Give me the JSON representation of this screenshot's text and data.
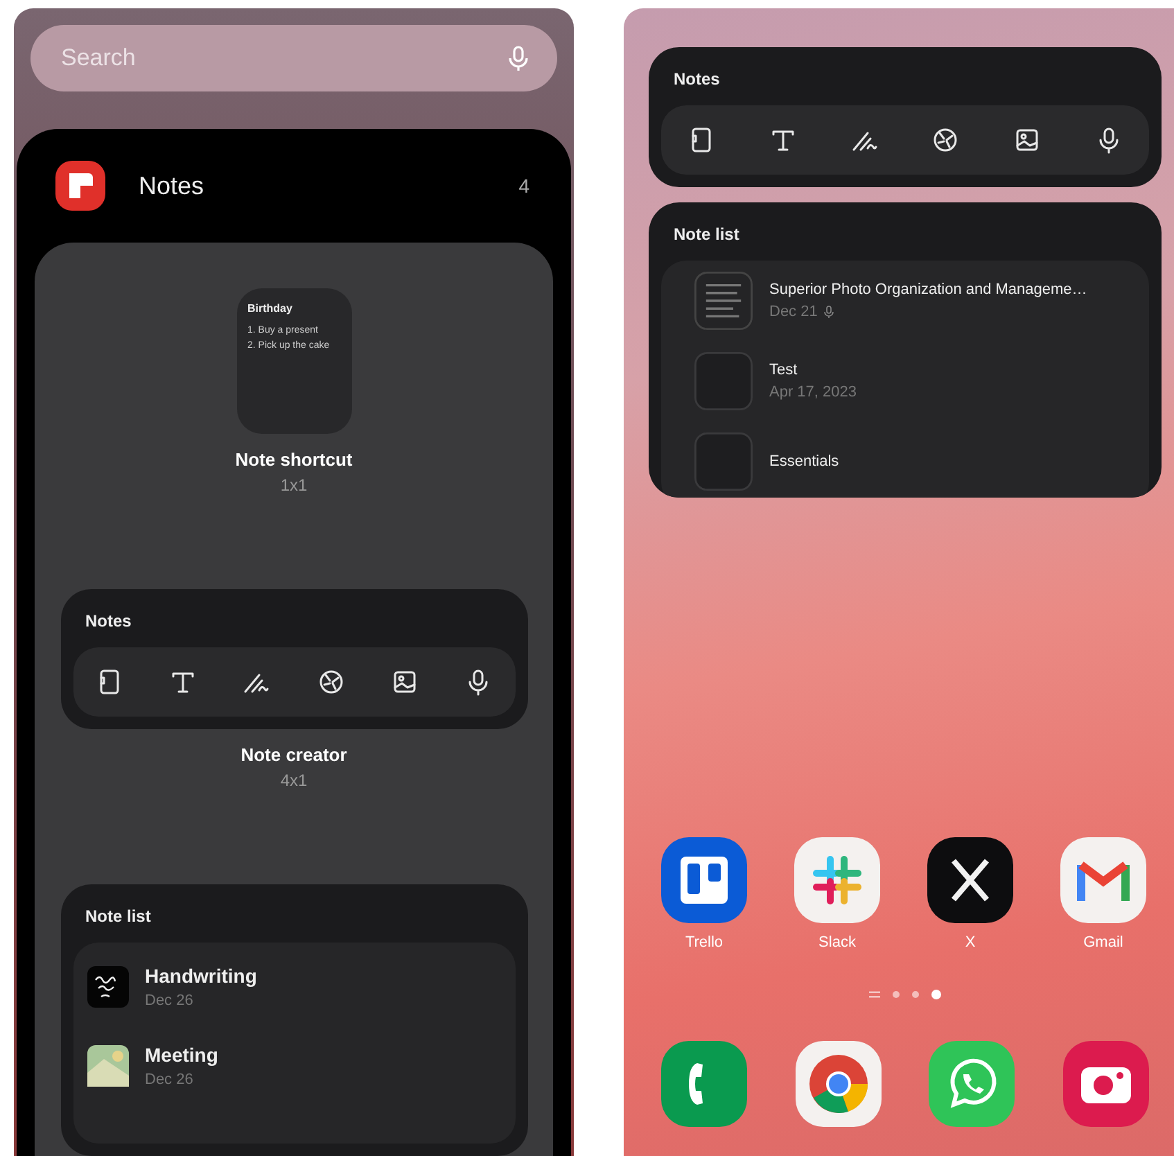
{
  "left_screen": {
    "search": {
      "placeholder": "Search"
    },
    "app": {
      "name": "Notes",
      "count": "4"
    },
    "widgets": [
      {
        "kind": "shortcut",
        "preview": {
          "title": "Birthday",
          "lines": [
            "1. Buy a present",
            "2. Pick up the cake"
          ]
        },
        "name": "Note shortcut",
        "size": "1x1"
      },
      {
        "kind": "creator",
        "title": "Notes",
        "name": "Note creator",
        "size": "4x1"
      },
      {
        "kind": "list",
        "title": "Note list",
        "items": [
          {
            "title": "Handwriting",
            "date": "Dec 26",
            "kind": "handwriting"
          },
          {
            "title": "Meeting",
            "date": "Dec 26",
            "kind": "photo"
          }
        ]
      }
    ]
  },
  "right_screen": {
    "widgets": [
      {
        "kind": "creator",
        "title": "Notes"
      },
      {
        "kind": "list",
        "title": "Note list",
        "items": [
          {
            "title": "Superior Photo Organization and Manageme…",
            "date": "Dec 21",
            "voice": true,
            "kind": "document"
          },
          {
            "title": "Test",
            "date": "Apr 17, 2023",
            "voice": false,
            "kind": "blank"
          },
          {
            "title": "Essentials",
            "kind": "blank"
          }
        ]
      }
    ],
    "apps": [
      {
        "label": "Trello",
        "kind": "board"
      },
      {
        "label": "Slack",
        "kind": "hash"
      },
      {
        "label": "X",
        "kind": "cross"
      },
      {
        "label": "Gmail",
        "kind": "mail"
      }
    ],
    "page_indicator": [
      {
        "kind": "lines",
        "selected": false
      },
      {
        "kind": "dot",
        "selected": false
      },
      {
        "kind": "dot",
        "selected": false
      },
      {
        "kind": "dot",
        "selected": true
      }
    ],
    "dock": [
      {
        "kind": "phone"
      },
      {
        "kind": "browser"
      },
      {
        "kind": "chat"
      },
      {
        "kind": "camera"
      }
    ]
  }
}
